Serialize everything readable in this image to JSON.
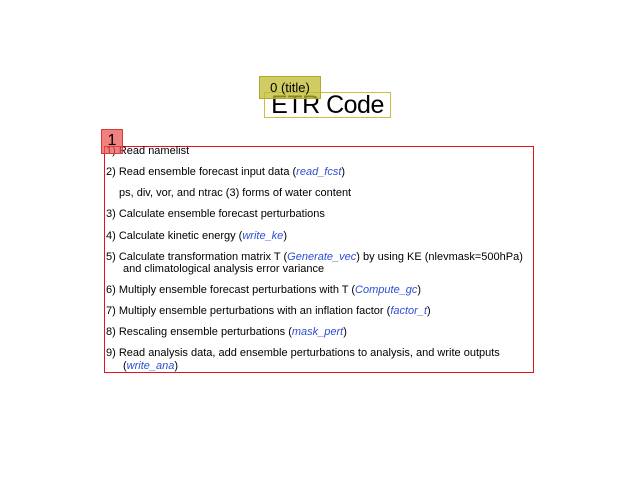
{
  "slide": {
    "title": "ETR Code",
    "tags": {
      "title_tag": "0 (title)",
      "body_tag": "1"
    },
    "colors": {
      "title_box_border": "#c8c040",
      "title_tag_fill": "#beb828",
      "body_box_border": "#e8101c",
      "body_tag_fill": "#ec5050",
      "function_name": "#2c4fd6"
    },
    "items": [
      {
        "pre": "1) Read namelist"
      },
      {
        "pre": "2) Read ensemble forecast input data (",
        "fn": "read_fcst",
        "post": ")"
      },
      {
        "pre": "ps, div, vor, and ntrac (3) forms of water content"
      },
      {
        "pre": "3) Calculate ensemble forecast perturbations"
      },
      {
        "pre": "4) Calculate kinetic energy (",
        "fn": "write_ke",
        "post": ")"
      },
      {
        "pre": "5) Calculate transformation matrix T (",
        "fn": "Generate_vec",
        "post": ") by using KE (nlevmask=500hPa)"
      },
      {
        "pre": "and climatological analysis error variance"
      },
      {
        "pre": "6) Multiply ensemble forecast perturbations with T (",
        "fn": "Compute_gc",
        "post": ")"
      },
      {
        "pre": "7) Multiply ensemble perturbations with an inflation factor (",
        "fn": "factor_t",
        "post": ")"
      },
      {
        "pre": "8) Rescaling ensemble perturbations (",
        "fn": "mask_pert",
        "post": ")"
      },
      {
        "pre": "9) Read analysis data, add ensemble perturbations to analysis, and write outputs"
      },
      {
        "pre": "(",
        "fn": "write_ana",
        "post": ")"
      }
    ]
  }
}
